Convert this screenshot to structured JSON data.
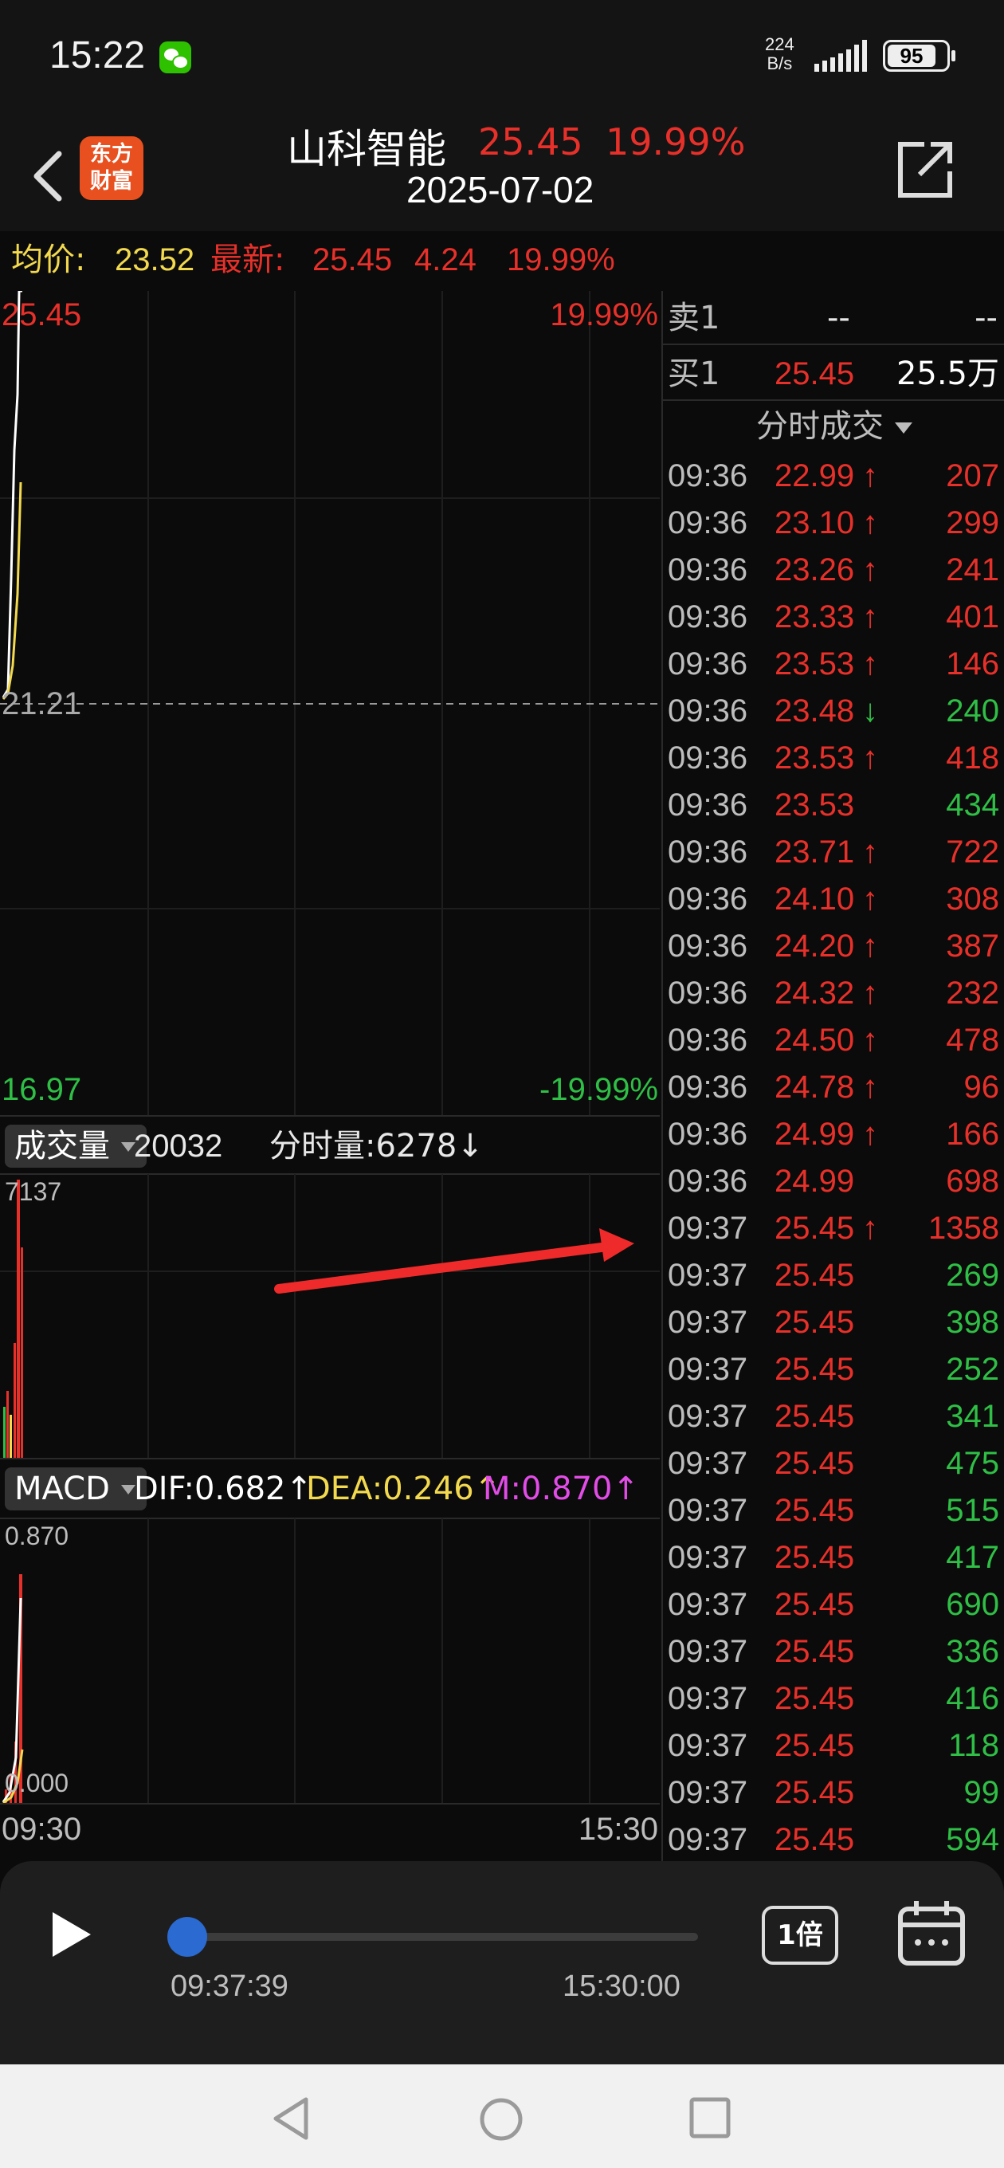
{
  "status_bar": {
    "time": "15:22",
    "net_speed_value": "224",
    "net_speed_unit": "B/s",
    "battery": "95"
  },
  "header": {
    "logo_line1": "东方",
    "logo_line2": "财富",
    "stock_name": "山科智能",
    "price": "25.45",
    "change_pct": "19.99%",
    "date": "2025-07-02"
  },
  "info": {
    "avg_label": "均价:",
    "avg_value": "23.52",
    "latest_label": "最新:",
    "latest_value": "25.45",
    "change": "4.24",
    "change_pct": "19.99%"
  },
  "chart": {
    "price_top": "25.45",
    "pct_top": "19.99%",
    "price_mid": "21.21",
    "price_bottom": "16.97",
    "pct_bottom": "-19.99%",
    "volume_label": "成交量",
    "volume_total": "20032",
    "volume_current": "分时量:6278↓",
    "volume_max": "7137",
    "macd_label": "MACD",
    "dif": "DIF:0.682↑",
    "dea": "DEA:0.246↑",
    "m": "M:0.870↑",
    "macd_top": "0.870",
    "macd_zero": "0.000",
    "time_start": "09:30",
    "time_end": "15:30"
  },
  "order_book": {
    "sell1_label": "卖1",
    "sell1_price": "--",
    "sell1_vol": "--",
    "buy1_label": "买1",
    "buy1_price": "25.45",
    "buy1_vol": "25.5万"
  },
  "ticks_title": "分时成交",
  "ticks": [
    {
      "time": "09:36",
      "price": "22.99",
      "arrow": "↑",
      "vol": "207",
      "vol_color": "#e8302a"
    },
    {
      "time": "09:36",
      "price": "23.10",
      "arrow": "↑",
      "vol": "299",
      "vol_color": "#e8302a"
    },
    {
      "time": "09:36",
      "price": "23.26",
      "arrow": "↑",
      "vol": "241",
      "vol_color": "#e8302a"
    },
    {
      "time": "09:36",
      "price": "23.33",
      "arrow": "↑",
      "vol": "401",
      "vol_color": "#e8302a"
    },
    {
      "time": "09:36",
      "price": "23.53",
      "arrow": "↑",
      "vol": "146",
      "vol_color": "#e8302a"
    },
    {
      "time": "09:36",
      "price": "23.48",
      "arrow": "↓",
      "vol": "240",
      "vol_color": "#2fbf46"
    },
    {
      "time": "09:36",
      "price": "23.53",
      "arrow": "↑",
      "vol": "418",
      "vol_color": "#e8302a"
    },
    {
      "time": "09:36",
      "price": "23.53",
      "arrow": "",
      "vol": "434",
      "vol_color": "#2fbf46"
    },
    {
      "time": "09:36",
      "price": "23.71",
      "arrow": "↑",
      "vol": "722",
      "vol_color": "#e8302a"
    },
    {
      "time": "09:36",
      "price": "24.10",
      "arrow": "↑",
      "vol": "308",
      "vol_color": "#e8302a"
    },
    {
      "time": "09:36",
      "price": "24.20",
      "arrow": "↑",
      "vol": "387",
      "vol_color": "#e8302a"
    },
    {
      "time": "09:36",
      "price": "24.32",
      "arrow": "↑",
      "vol": "232",
      "vol_color": "#e8302a"
    },
    {
      "time": "09:36",
      "price": "24.50",
      "arrow": "↑",
      "vol": "478",
      "vol_color": "#e8302a"
    },
    {
      "time": "09:36",
      "price": "24.78",
      "arrow": "↑",
      "vol": "96",
      "vol_color": "#e8302a"
    },
    {
      "time": "09:36",
      "price": "24.99",
      "arrow": "↑",
      "vol": "166",
      "vol_color": "#e8302a"
    },
    {
      "time": "09:36",
      "price": "24.99",
      "arrow": "",
      "vol": "698",
      "vol_color": "#e8302a"
    },
    {
      "time": "09:37",
      "price": "25.45",
      "arrow": "↑",
      "vol": "1358",
      "vol_color": "#e8302a"
    },
    {
      "time": "09:37",
      "price": "25.45",
      "arrow": "",
      "vol": "269",
      "vol_color": "#2fbf46"
    },
    {
      "time": "09:37",
      "price": "25.45",
      "arrow": "",
      "vol": "398",
      "vol_color": "#2fbf46"
    },
    {
      "time": "09:37",
      "price": "25.45",
      "arrow": "",
      "vol": "252",
      "vol_color": "#2fbf46"
    },
    {
      "time": "09:37",
      "price": "25.45",
      "arrow": "",
      "vol": "341",
      "vol_color": "#2fbf46"
    },
    {
      "time": "09:37",
      "price": "25.45",
      "arrow": "",
      "vol": "475",
      "vol_color": "#2fbf46"
    },
    {
      "time": "09:37",
      "price": "25.45",
      "arrow": "",
      "vol": "515",
      "vol_color": "#2fbf46"
    },
    {
      "time": "09:37",
      "price": "25.45",
      "arrow": "",
      "vol": "417",
      "vol_color": "#2fbf46"
    },
    {
      "time": "09:37",
      "price": "25.45",
      "arrow": "",
      "vol": "690",
      "vol_color": "#2fbf46"
    },
    {
      "time": "09:37",
      "price": "25.45",
      "arrow": "",
      "vol": "336",
      "vol_color": "#2fbf46"
    },
    {
      "time": "09:37",
      "price": "25.45",
      "arrow": "",
      "vol": "416",
      "vol_color": "#2fbf46"
    },
    {
      "time": "09:37",
      "price": "25.45",
      "arrow": "",
      "vol": "118",
      "vol_color": "#2fbf46"
    },
    {
      "time": "09:37",
      "price": "25.45",
      "arrow": "",
      "vol": "99",
      "vol_color": "#2fbf46"
    },
    {
      "time": "09:37",
      "price": "25.45",
      "arrow": "",
      "vol": "594",
      "vol_color": "#2fbf46"
    }
  ],
  "playback": {
    "current_time": "09:37:39",
    "end_time": "15:30:00",
    "speed_label": "1倍",
    "progress_fraction": 0.0
  },
  "colors": {
    "up": "#e8302a",
    "down": "#2fbf46",
    "avg_yellow": "#f2d94e",
    "macd_magenta": "#e24ce6",
    "progress_blue": "#2a6ad1"
  }
}
